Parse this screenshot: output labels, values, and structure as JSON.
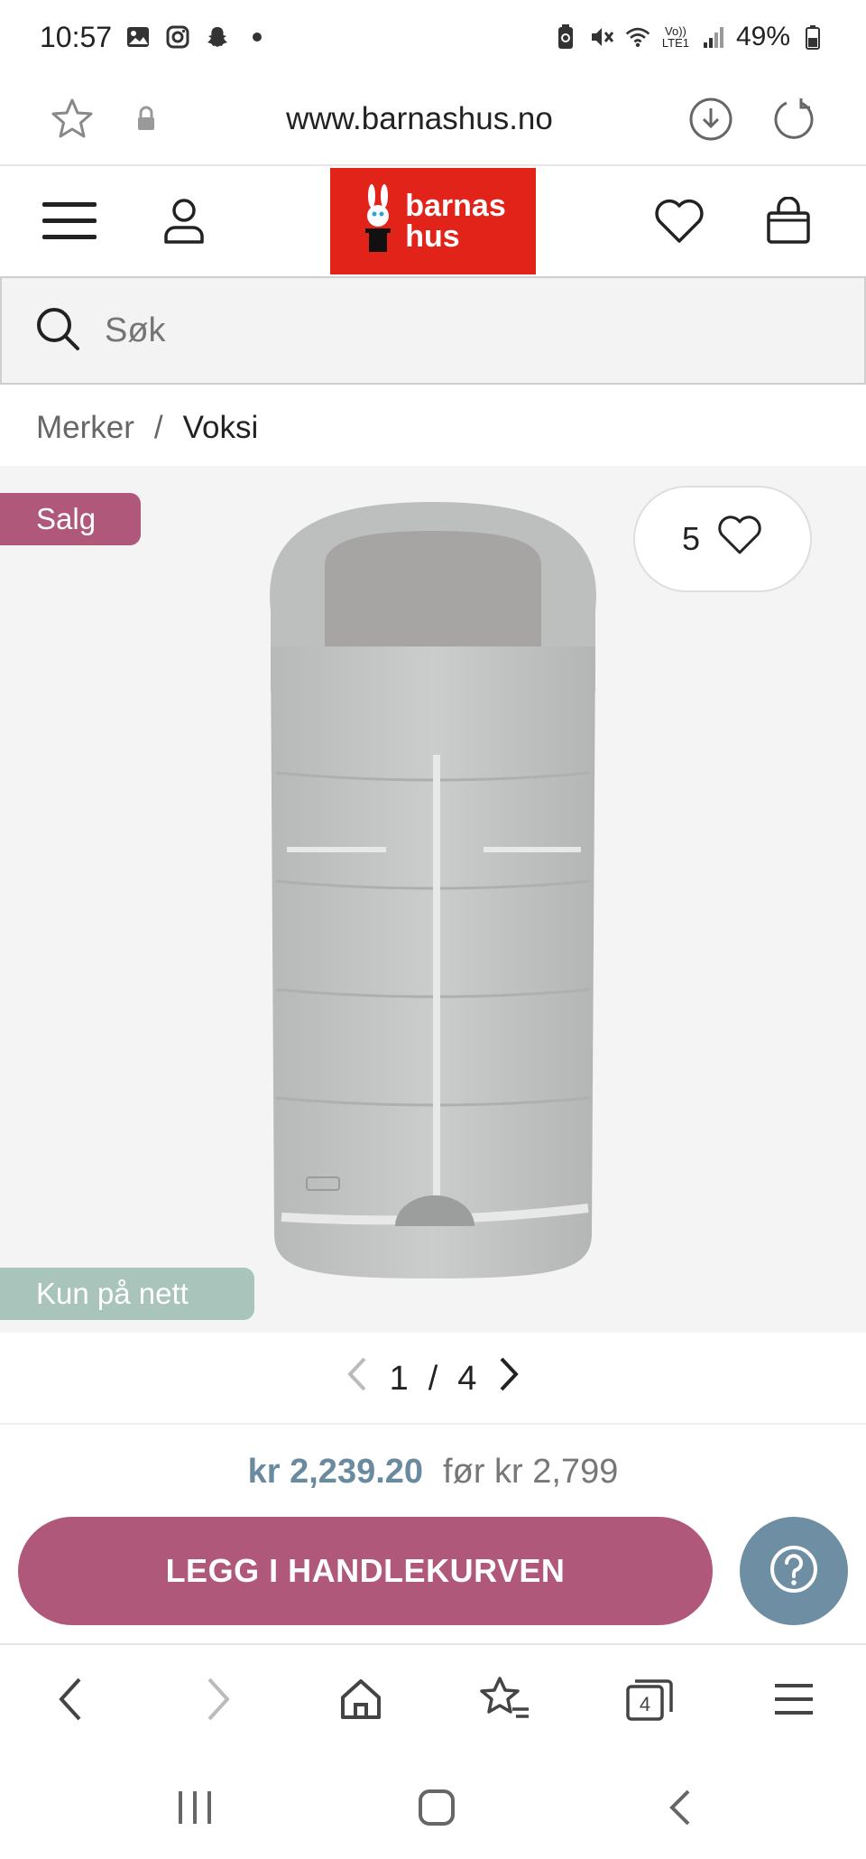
{
  "status_bar": {
    "time": "10:57",
    "battery": "49%",
    "network": "Vo)) LTE1"
  },
  "browser": {
    "url": "www.barnashus.no"
  },
  "site": {
    "logo_line1": "barnas",
    "logo_line2": "hus",
    "brand_color": "#e2231a"
  },
  "search": {
    "placeholder": "Søk"
  },
  "breadcrumb": {
    "items": [
      "Merker",
      "Voksi"
    ],
    "separator": "/"
  },
  "product": {
    "badge_sale": "Salg",
    "badge_online": "Kun på nett",
    "favorites_count": "5",
    "image_name": "grey footmuff sleeping bag"
  },
  "gallery": {
    "current": "1",
    "separator": "/",
    "total": "4"
  },
  "price": {
    "current": "kr 2,239.20",
    "before": "før kr 2,799"
  },
  "cta": {
    "label": "LEGG I HANDLEKURVEN",
    "color": "#b0587a"
  },
  "help": {
    "icon": "question-icon",
    "color": "#6e8ea3"
  },
  "browser_nav": {
    "tabs_count": "4"
  }
}
